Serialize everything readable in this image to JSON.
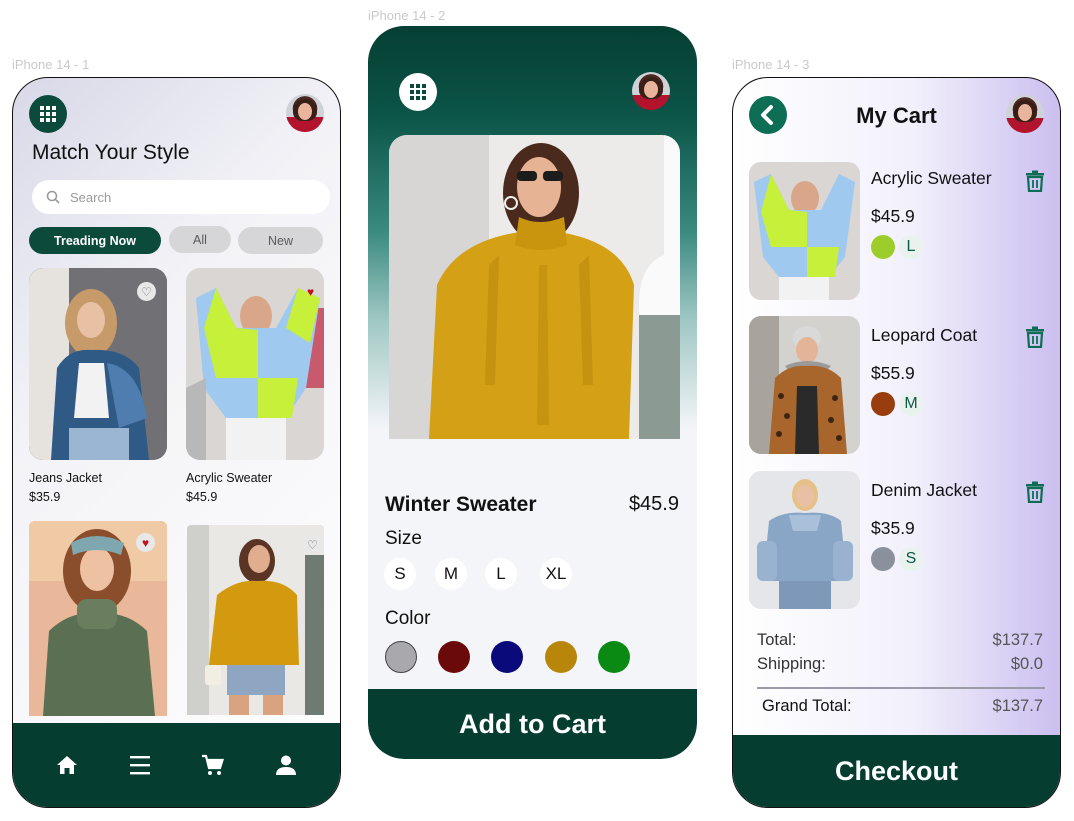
{
  "frames": {
    "frame1_label": "iPhone 14 - 1",
    "frame2_label": "iPhone 14 - 2",
    "frame3_label": "iPhone 14 - 3"
  },
  "home": {
    "title": "Match Your Style",
    "search_placeholder": "Search",
    "chips": [
      "Treading Now",
      "All",
      "New"
    ],
    "products": [
      {
        "name": "Jeans Jacket",
        "price": "$35.9",
        "favorited": false
      },
      {
        "name": "Acrylic Sweater",
        "price": "$45.9",
        "favorited": true
      },
      {
        "favorited": true
      },
      {
        "favorited": false
      }
    ],
    "nav": [
      "home-icon",
      "menu-icon",
      "cart-icon",
      "profile-icon"
    ]
  },
  "product": {
    "name": "Winter Sweater",
    "price": "$45.9",
    "size_label": "Size",
    "sizes": [
      "S",
      "M",
      "L",
      "XL"
    ],
    "color_label": "Color",
    "colors": [
      "#a9a9ad",
      "#6b0a0a",
      "#0a0a7a",
      "#b8860b",
      "#0a8a12"
    ],
    "add_button": "Add to Cart"
  },
  "cart": {
    "title": "My Cart",
    "items": [
      {
        "name": "Acrylic Sweater",
        "price": "$45.9",
        "color": "#9ccd2b",
        "size": "L"
      },
      {
        "name": "Leopard Coat",
        "price": "$55.9",
        "color": "#9a3d0e",
        "size": "M"
      },
      {
        "name": "Denim Jacket",
        "price": "$35.9",
        "color": "#8a909c",
        "size": "S"
      }
    ],
    "total_label": "Total:",
    "total_value": "$137.7",
    "shipping_label": "Shipping:",
    "shipping_value": "$0.0",
    "grand_label": "Grand Total:",
    "grand_value": "$137.7",
    "checkout_button": "Checkout"
  },
  "colors": {
    "brand_dark": "#053d31",
    "brand_teal": "#0d6e55"
  }
}
